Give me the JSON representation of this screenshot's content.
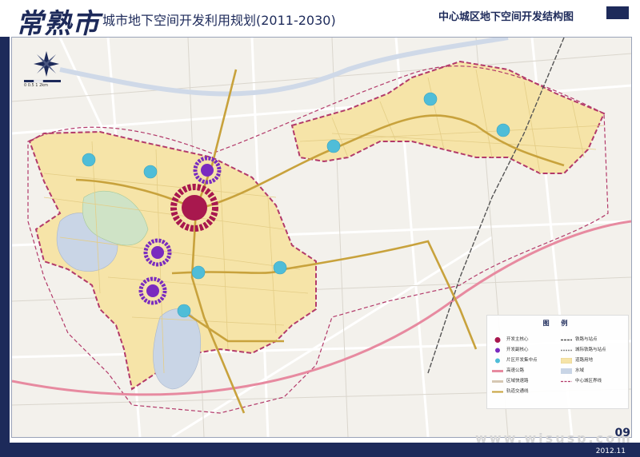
{
  "header": {
    "brand": "常熟市",
    "title": "城市地下空间开发利用规划(2011-2030)",
    "subtitle": "中心城区地下空间开发结构图"
  },
  "legend": {
    "title": "图 例",
    "left": [
      {
        "label": "开发主核心",
        "symbol": "main-core-icon",
        "color": "#a8184e"
      },
      {
        "label": "开发副核心",
        "symbol": "sub-core-icon",
        "color": "#7a2bbf"
      },
      {
        "label": "片区开发集中点",
        "symbol": "district-point-icon",
        "color": "#4fbdd8"
      },
      {
        "label": "高速公路",
        "symbol": "expressway-line",
        "color": "#e78aa0"
      },
      {
        "label": "区域快速路",
        "symbol": "expressroad-line",
        "color": "#d6c7b3"
      },
      {
        "label": "轨道交通线",
        "symbol": "metro-line",
        "color": "#c8a23c"
      }
    ],
    "right": [
      {
        "label": "铁路与站点",
        "symbol": "railway-line",
        "color": "#555555"
      },
      {
        "label": "城际铁路与站点",
        "symbol": "intercity-railway-line",
        "color": "#888888"
      },
      {
        "label": "道路用地",
        "symbol": "road-land-swatch",
        "color": "#f6e4a8"
      },
      {
        "label": "水域",
        "symbol": "water-swatch",
        "color": "#c9d5e6"
      },
      {
        "label": "中心城区界线",
        "symbol": "boundary-line",
        "color": "#b33a6a"
      }
    ]
  },
  "scale": {
    "label": "0 0.5 1 2km"
  },
  "page": {
    "number": "09",
    "date": "2012.11"
  },
  "watermark": "www.wisusp.com",
  "colors": {
    "brand": "#1d2a5a",
    "boundary": "#b33a6a",
    "plan_area": "#f6e4a8",
    "metro": "#c8a23c",
    "water": "#c9d5e6",
    "main_core": "#a8184e",
    "sub_core": "#7a2bbf",
    "district_point": "#4fbdd8"
  }
}
